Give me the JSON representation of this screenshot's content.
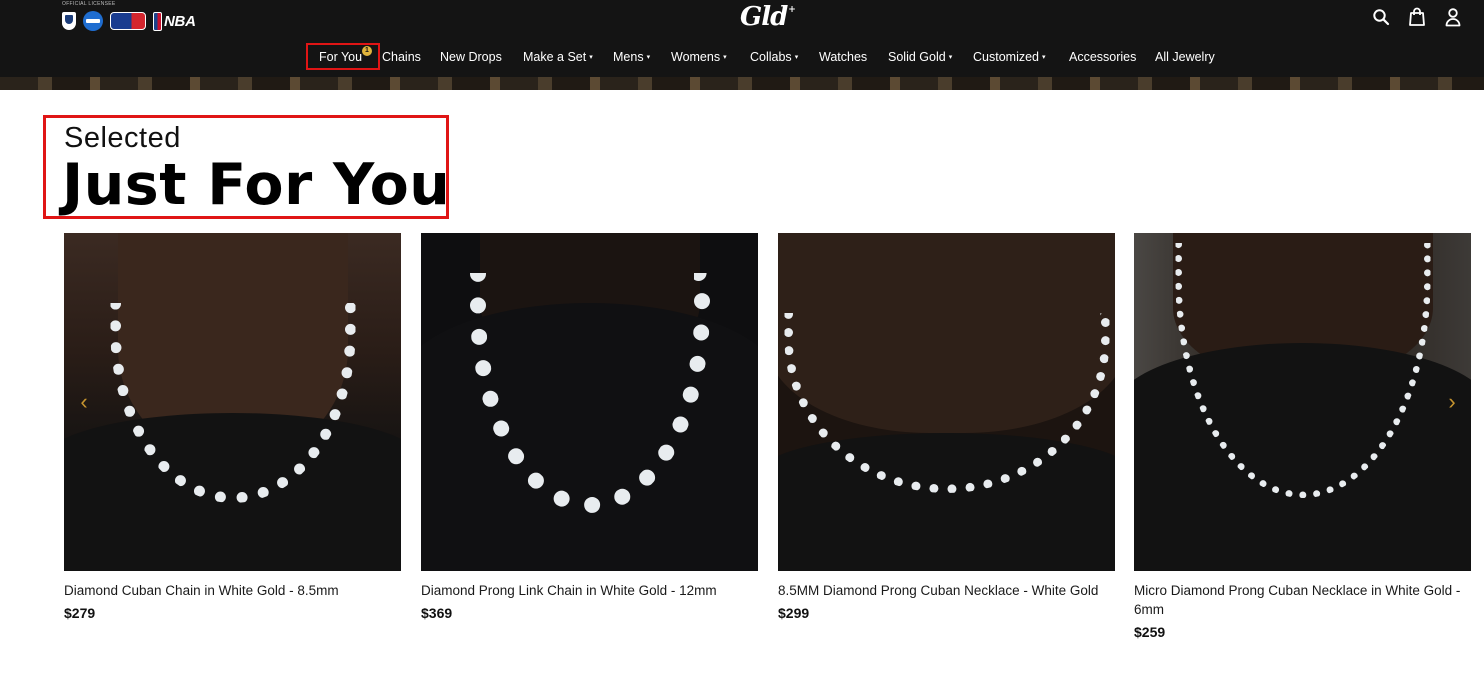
{
  "header": {
    "licensee": "OFFICIAL LICENSEE",
    "leagues": [
      "NFL",
      "NCAA",
      "MLB",
      "NBA"
    ],
    "nba_text": "NBA",
    "logo": "Gld",
    "logo_mark": "+",
    "icons": [
      "search-icon",
      "cart-icon",
      "user-icon"
    ]
  },
  "nav": {
    "items": [
      {
        "label": "For You",
        "badge": "1",
        "caret": false
      },
      {
        "label": "Chains",
        "caret": false
      },
      {
        "label": "New Drops",
        "caret": false
      },
      {
        "label": "Make a Set",
        "caret": true
      },
      {
        "label": "Mens",
        "caret": true
      },
      {
        "label": "Womens",
        "caret": true
      },
      {
        "label": "Collabs",
        "caret": true
      },
      {
        "label": "Watches",
        "caret": false
      },
      {
        "label": "Solid Gold",
        "caret": true
      },
      {
        "label": "Customized",
        "caret": true
      },
      {
        "label": "Accessories",
        "caret": false
      },
      {
        "label": "All Jewelry",
        "caret": false
      }
    ],
    "caret_glyph": "▾"
  },
  "section": {
    "subtitle": "Selected",
    "title": "Just For You"
  },
  "products": [
    {
      "name": "Diamond Cuban Chain in White Gold - 8.5mm",
      "price": "$279"
    },
    {
      "name": "Diamond Prong Link Chain in White Gold - 12mm",
      "price": "$369"
    },
    {
      "name": "8.5MM Diamond Prong Cuban Necklace - White Gold",
      "price": "$299"
    },
    {
      "name": "Micro Diamond Prong Cuban Necklace in White Gold - 6mm",
      "price": "$259"
    }
  ],
  "carousel": {
    "prev": "‹",
    "next": "›"
  },
  "colors": {
    "header_bg": "#141414",
    "accent": "#c7952f",
    "highlight": "#e01515"
  }
}
